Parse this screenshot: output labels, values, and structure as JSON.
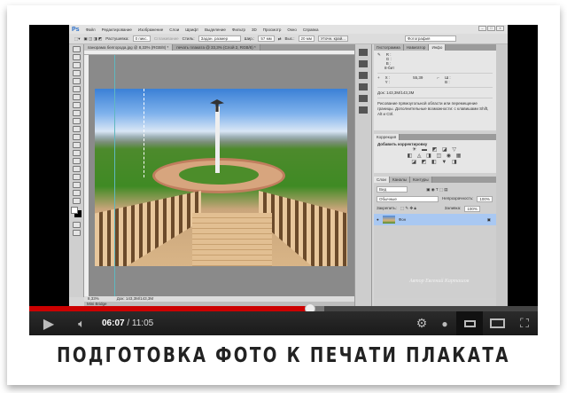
{
  "photoshop": {
    "logo": "Ps",
    "menu": [
      "Файл",
      "Редактирование",
      "Изображение",
      "Слои",
      "Шрифт",
      "Выделение",
      "Фильтр",
      "3D",
      "Просмотр",
      "Окно",
      "Справка"
    ],
    "options": {
      "feather_label": "Растушевка:",
      "feather_value": "0 пикс.",
      "antialias_label": "Сглаживание",
      "style_label": "Стиль:",
      "style_value": "Задан. размер",
      "width_label": "Шир.:",
      "width_value": "57 мм",
      "height_label": "Выс.:",
      "height_value": "20 мм",
      "refine_button": "Уточн. край...",
      "workspace": "Фотография"
    },
    "doc_tabs": [
      "панорама белгорода.jpg @ 8,33% (RGB/8) *",
      "печать плаката @ 33,3% (Слой 2, RGB/8) *"
    ],
    "status": {
      "zoom": "8,33%",
      "doc": "Док: 143,3M/143,3M"
    },
    "mini_bridge": "Mini Bridge",
    "info_panel": {
      "tabs": [
        "Гистограмма",
        "Навигатор",
        "Инфо"
      ],
      "rgb": [
        "R :",
        "G :",
        "B :"
      ],
      "bits": "8-бит",
      "xy": [
        "X :",
        "Y :"
      ],
      "value": "55,39",
      "wh": [
        "Ш :",
        "В :"
      ],
      "doc": "Док: 143,3M/143,3M",
      "hint": "Рисование прямоугольной области или перемещение границы. Дополнительные возможности: с клавишами Shift, Alt и Ctrl."
    },
    "corrections_panel": {
      "tab": "Коррекция",
      "title": "Добавить корректировку"
    },
    "layers_panel": {
      "tabs": [
        "Слои",
        "Каналы",
        "Контуры"
      ],
      "filter": "Вид",
      "blend_mode": "Обычные",
      "opacity_label": "Непрозрачность:",
      "opacity_value": "100%",
      "lock_label": "Закрепить:",
      "fill_label": "Заливка:",
      "fill_value": "100%",
      "layer_name": "Фон"
    },
    "watermark": "Автор Евгений Карташов"
  },
  "player": {
    "current_time": "06:07",
    "separator": " / ",
    "duration": "11:05",
    "progress": 0.553,
    "colors": {
      "played": "#cc0000"
    }
  },
  "caption": "ПОДГОТОВКА ФОТО К ПЕЧАТИ ПЛАКАТА"
}
